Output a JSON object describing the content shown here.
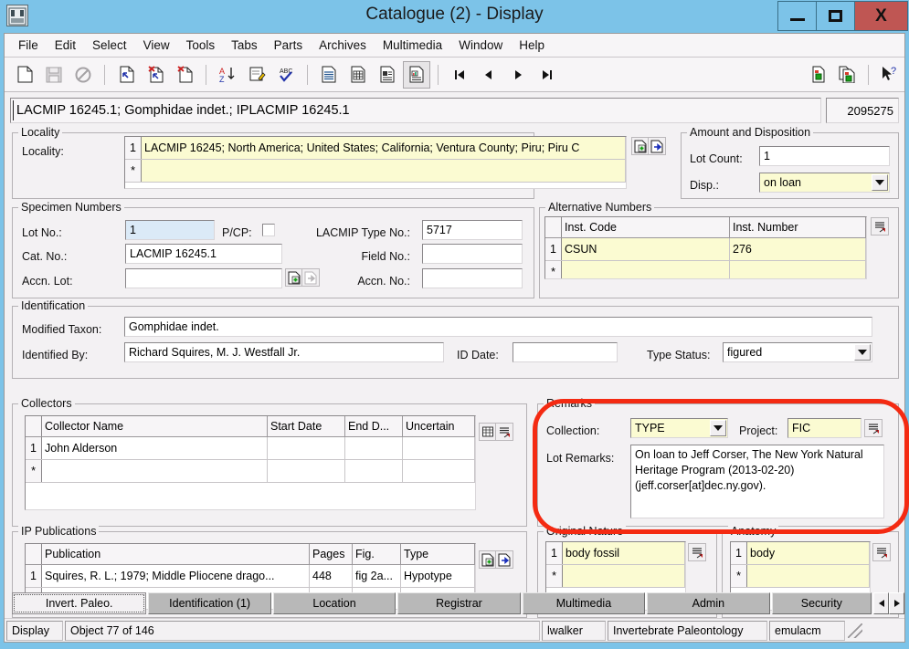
{
  "window": {
    "title": "Catalogue (2) - Display",
    "icon_label": "EMu",
    "minimize_label": "_",
    "maximize_label": "□",
    "close_label": "X",
    "accent_title_bg": "#7cc3e8",
    "close_btn_bg": "#bf5653"
  },
  "menu": {
    "items": [
      "File",
      "Edit",
      "Select",
      "View",
      "Tools",
      "Tabs",
      "Parts",
      "Archives",
      "Multimedia",
      "Window",
      "Help"
    ]
  },
  "toolbar": {
    "items": [
      {
        "name": "new-record-icon",
        "label": "New"
      },
      {
        "name": "save-icon",
        "label": "Save"
      },
      {
        "name": "discard-changes-icon",
        "label": "Discard"
      },
      {
        "name": "insert-record-icon",
        "label": "Insert"
      },
      {
        "name": "delete-record-icon",
        "label": "Delete"
      },
      {
        "name": "delete-page-icon",
        "label": "Delete Page"
      },
      {
        "name": "sort-az-icon",
        "label": "Sort"
      },
      {
        "name": "edit-note-icon",
        "label": "Edit Note"
      },
      {
        "name": "spellcheck-icon",
        "label": "Spell Check"
      },
      {
        "name": "list-view-icon",
        "label": "List View"
      },
      {
        "name": "table-view-icon",
        "label": "Table View"
      },
      {
        "name": "page-view-icon",
        "label": "Page View"
      },
      {
        "name": "details-view-icon",
        "label": "Details View"
      },
      {
        "name": "first-record-icon",
        "label": "First"
      },
      {
        "name": "previous-record-icon",
        "label": "Previous"
      },
      {
        "name": "next-record-icon",
        "label": "Next"
      },
      {
        "name": "last-record-icon",
        "label": "Last"
      },
      {
        "name": "copy-record-icon",
        "label": "Copy Record"
      },
      {
        "name": "duplicate-record-icon",
        "label": "Duplicate Record"
      },
      {
        "name": "context-help-icon",
        "label": "Help"
      }
    ],
    "active_index": 12
  },
  "record_header": {
    "summary": "LACMIP 16245.1; Gomphidae indet.; IPLACMIP 16245.1",
    "irn": "2095275"
  },
  "locality": {
    "legend": "Locality",
    "field_label": "Locality:",
    "rows": [
      {
        "num": "1",
        "value": "LACMIP 16245; North America; United States; California; Ventura County; Piru; Piru C"
      },
      {
        "num": "*",
        "value": ""
      }
    ],
    "attach_button": "attach-icon",
    "goto_button": "goto-icon"
  },
  "amount_disposition": {
    "legend": "Amount and Disposition",
    "lot_count_label": "Lot Count:",
    "lot_count_value": "1",
    "disp_label": "Disp.:",
    "disp_value": "on loan"
  },
  "specimen_numbers": {
    "legend": "Specimen Numbers",
    "lot_no_label": "Lot No.:",
    "lot_no_value": "1",
    "pcp_label": "P/CP:",
    "pcp_checked": false,
    "cat_no_label": "Cat. No.:",
    "cat_no_value": "LACMIP 16245.1",
    "accn_lot_label": "Accn. Lot:",
    "accn_lot_value": "",
    "lacmip_type_no_label": "LACMIP Type No.:",
    "lacmip_type_no_value": "5717",
    "field_no_label": "Field No.:",
    "field_no_value": "",
    "accn_no_label": "Accn. No.:",
    "accn_no_value": ""
  },
  "alternative_numbers": {
    "legend": "Alternative Numbers",
    "columns": [
      "",
      "Inst. Code",
      "Inst. Number"
    ],
    "rows": [
      {
        "num": "1",
        "inst_code": "CSUN",
        "inst_number": "276"
      },
      {
        "num": "*",
        "inst_code": "",
        "inst_number": ""
      }
    ]
  },
  "identification": {
    "legend": "Identification",
    "modified_taxon_label": "Modified Taxon:",
    "modified_taxon_value": "Gomphidae indet.",
    "identified_by_label": "Identified By:",
    "identified_by_value": "Richard Squires, M. J. Westfall Jr.",
    "id_date_label": "ID Date:",
    "id_date_value": "",
    "type_status_label": "Type Status:",
    "type_status_value": "figured"
  },
  "collectors": {
    "legend": "Collectors",
    "columns": [
      "",
      "Collector Name",
      "Start Date",
      "End D...",
      "Uncertain"
    ],
    "rows": [
      {
        "num": "1",
        "name": "John Alderson",
        "start": "",
        "end": "",
        "uncertain": ""
      },
      {
        "num": "*",
        "name": "",
        "start": "",
        "end": "",
        "uncertain": ""
      }
    ]
  },
  "remarks": {
    "legend": "Remarks",
    "collection_label": "Collection:",
    "collection_value": "TYPE",
    "project_label": "Project:",
    "project_value": "FIC",
    "lot_remarks_label": "Lot Remarks:",
    "lot_remarks_value": "On loan to Jeff Corser, The New York Natural Heritage Program (2013-02-20) (jeff.corser[at]dec.ny.gov).",
    "highlight_color": "#f42a12"
  },
  "ip_publications": {
    "legend": "IP Publications",
    "columns": [
      "",
      "Publication",
      "Pages",
      "Fig.",
      "Type"
    ],
    "rows": [
      {
        "num": "1",
        "publication": "Squires, R. L.; 1979; Middle Pliocene drago...",
        "pages": "448",
        "fig": "fig 2a...",
        "type": "Hypotype"
      },
      {
        "num": "*",
        "publication": "",
        "pages": "",
        "fig": "",
        "type": ""
      }
    ]
  },
  "original_nature": {
    "legend": "Original Nature",
    "rows": [
      {
        "num": "1",
        "value": "body fossil"
      },
      {
        "num": "*",
        "value": ""
      }
    ]
  },
  "anatomy": {
    "legend": "Anatomy",
    "rows": [
      {
        "num": "1",
        "value": "body"
      },
      {
        "num": "*",
        "value": ""
      }
    ]
  },
  "tabs": {
    "items": [
      "Invert. Paleo.",
      "Identification (1)",
      "Location",
      "Registrar",
      "Multimedia",
      "Admin",
      "Security"
    ],
    "active": "Invert. Paleo.",
    "scroll_left": "◀",
    "scroll_right": "▶"
  },
  "status_bar": {
    "mode": "Display",
    "position": "Object 77 of 146",
    "user": "lwalker",
    "department": "Invertebrate Paleontology",
    "environment": "emulacm"
  }
}
